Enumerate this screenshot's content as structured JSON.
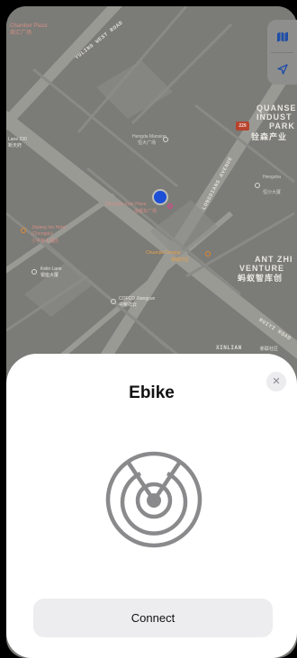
{
  "map": {
    "labels": {
      "top_left_1": "Chamber Plaza",
      "top_left_2": "商汇广场",
      "road_yuling": "YULING WEST ROAD",
      "quanse_1": "QUANSE",
      "quanse_2": "INDUST",
      "quanse_3": "PARK",
      "quanse_cn": "铨森产业",
      "metro": "229",
      "hengda_1": "Hengda Mansion",
      "hengda_2": "恒大广场",
      "chengdu_1": "Chengdu East Plaza",
      "chengdu_2": "成都东广场",
      "longquan_road": "LONGDIANG AVENUE",
      "hengsha_1": "Hengsha",
      "hengsha_2": "恒沙大厦",
      "left_hotel_1": "Jinjiang Inn Hotel",
      "left_hotel_2": "(Chengdu)",
      "left_hotel_cn": "小宇宙大酒店",
      "left_mid_1": "Kelin Lane",
      "left_mid_cn": "银座大厦",
      "chuanjia_1": "Chuanjia Dengqu",
      "chuanjia_2": "锦城灯区",
      "ant_1": "ANT ZHI",
      "ant_2": "VENTURE",
      "ant_cn": "蚂蚁智库创",
      "cofco_1": "COFCO Xiangyun",
      "cofco_2": "中粮祥云",
      "road_right": "RUIYI ROAD",
      "xinlian_1": "XINLIAN",
      "xinlian_2": "新联社区",
      "left_unit": "Lane 230",
      "left_unit_cn": "新天府"
    },
    "controls": {
      "map_mode_icon": "map-icon",
      "locate_icon": "location-arrow-icon"
    }
  },
  "sheet": {
    "title": "Ebike",
    "close_icon": "close-icon",
    "radar_icon": "radar-icon",
    "connect_label": "Connect"
  }
}
